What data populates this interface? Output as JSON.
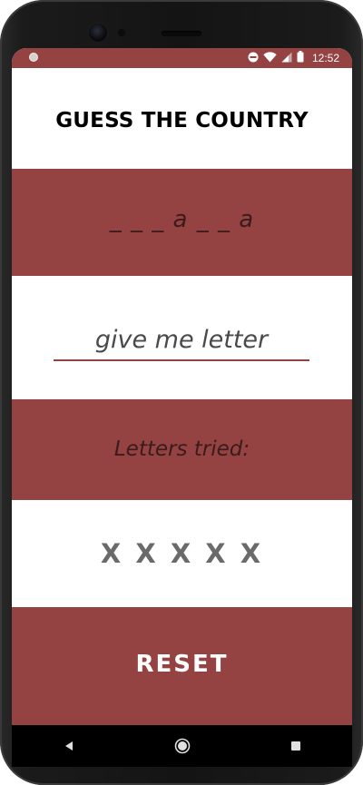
{
  "status_bar": {
    "time": "12:52",
    "icons": [
      "dnd-icon",
      "wifi-icon",
      "signal-icon",
      "battery-icon"
    ],
    "color": "#944242"
  },
  "game": {
    "title": "GUESS THE COUNTRY",
    "masked_word": "_ _ _ a _ _ a",
    "input_placeholder": "give me letter",
    "input_value": "",
    "tried_label": "Letters tried:",
    "tried_letters": "X X X X X",
    "reset_label": "RESET"
  },
  "nav_bar": {
    "buttons": [
      "back-icon",
      "home-icon",
      "recents-icon"
    ]
  },
  "colors": {
    "accent": "#944242",
    "band_white": "#ffffff",
    "title_text": "#000000",
    "muted_text": "#6a6a6a"
  }
}
